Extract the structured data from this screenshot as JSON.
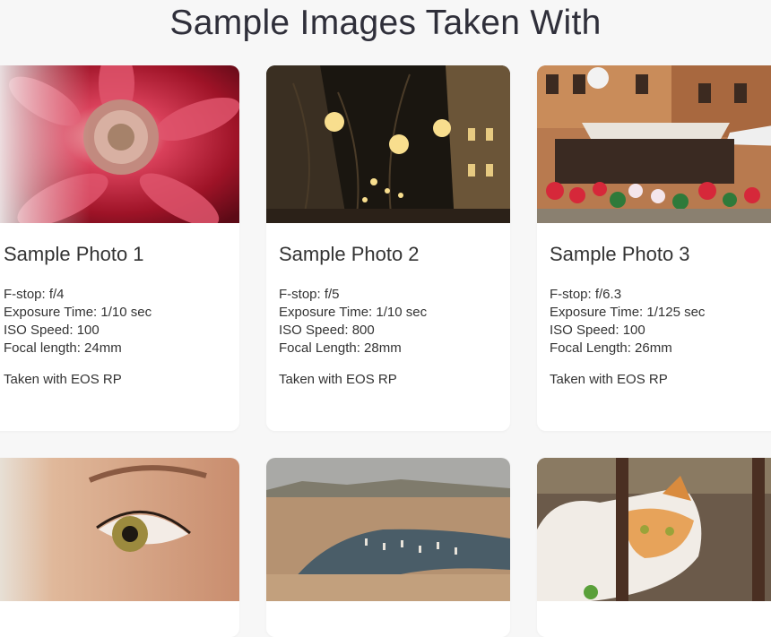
{
  "page": {
    "heading": "Sample Images Taken With"
  },
  "cards": [
    {
      "image": "pink-dahlia-flower-photo",
      "title": "Sample Photo 1",
      "specs": [
        "F-stop: f/4",
        "Exposure Time: 1/10 sec",
        "ISO Speed: 100",
        "Focal length: 24mm"
      ],
      "taken": "Taken with EOS RP"
    },
    {
      "image": "night-street-lights-photo",
      "title": "Sample Photo 2",
      "specs": [
        "F-stop: f/5",
        "Exposure Time: 1/10 sec",
        "ISO Speed: 800",
        "Focal Length: 28mm"
      ],
      "taken": "Taken with EOS RP"
    },
    {
      "image": "flower-market-photo",
      "title": "Sample Photo 3",
      "specs": [
        "F-stop: f/6.3",
        "Exposure Time: 1/125 sec",
        "ISO Speed: 100",
        "Focal Length: 26mm"
      ],
      "taken": "Taken with EOS RP"
    },
    {
      "image": "eye-closeup-photo"
    },
    {
      "image": "harbor-city-view-photo"
    },
    {
      "image": "orange-white-cat-photo"
    }
  ],
  "colors": {
    "background": "#f7f7f7",
    "card": "#ffffff",
    "text": "#333333"
  }
}
